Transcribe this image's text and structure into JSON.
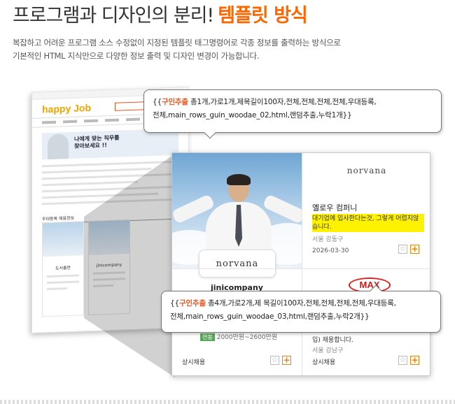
{
  "heading": {
    "main": "프로그램과 디자인의 분리!",
    "accent": "템플릿 방식"
  },
  "description": {
    "line1": "복잡하고 어려운 프로그램 소스 수정없이 지정된 템플릿 태그명령어로 각종 정보를 출력하는 방식으로",
    "line2": "기본적인 HTML 지식만으로 다양한 정보 출력 및 디자인 변경이 가능합니다."
  },
  "mini_site": {
    "logo_a": "happy",
    "logo_b": "Job",
    "banner_line1": "나에게 맞는 직무를",
    "banner_line2": "찾아보세요 !!",
    "section_title": "우대등록 채용정보",
    "card1_name": "도서출판",
    "card2_name": "jinicompany"
  },
  "cards": {
    "photo_logo": "norvana",
    "right_logo": "norvana",
    "right_company": "옐로우 컴퍼니",
    "right_title": "대기업에 입사한다는것, 그렇게 어렵지않습니다.",
    "right_location": "서울 강동구",
    "right_date": "2026-03-30",
    "second_left_company": "jinicompany",
    "second_left_salary_badge": "연봉",
    "second_left_salary": "2000만원~2600만원",
    "second_left_hire": "상시채용",
    "second_right_logo": "MAX",
    "second_right_text": "입) 채용합니다.",
    "second_right_location": "서울 강남구",
    "second_right_hire": "상시채용"
  },
  "callout1": {
    "open": "{{",
    "keyword": "구인추출",
    "line1_rest": " 총1개,가로1개,제목길이100자,전체,전체,전체,전체,우대등록,",
    "line2": "전체,main_rows_guin_woodae_02,html,랜덤추출,누락1개}}"
  },
  "callout2": {
    "open": "{{",
    "keyword": "구인추출",
    "line1_rest": " 총4개,가로2개,제 목길이100자,전체,전체,전체,전체,우대등록,",
    "line2": "전체,main_rows_guin_woodae_03,html,랜덤추출,누락2개}}"
  },
  "icons": {
    "star": "☆",
    "plus": "+"
  },
  "colors": {
    "accent": "#ff6600",
    "highlight": "#fff200",
    "plus": "#f08000"
  }
}
